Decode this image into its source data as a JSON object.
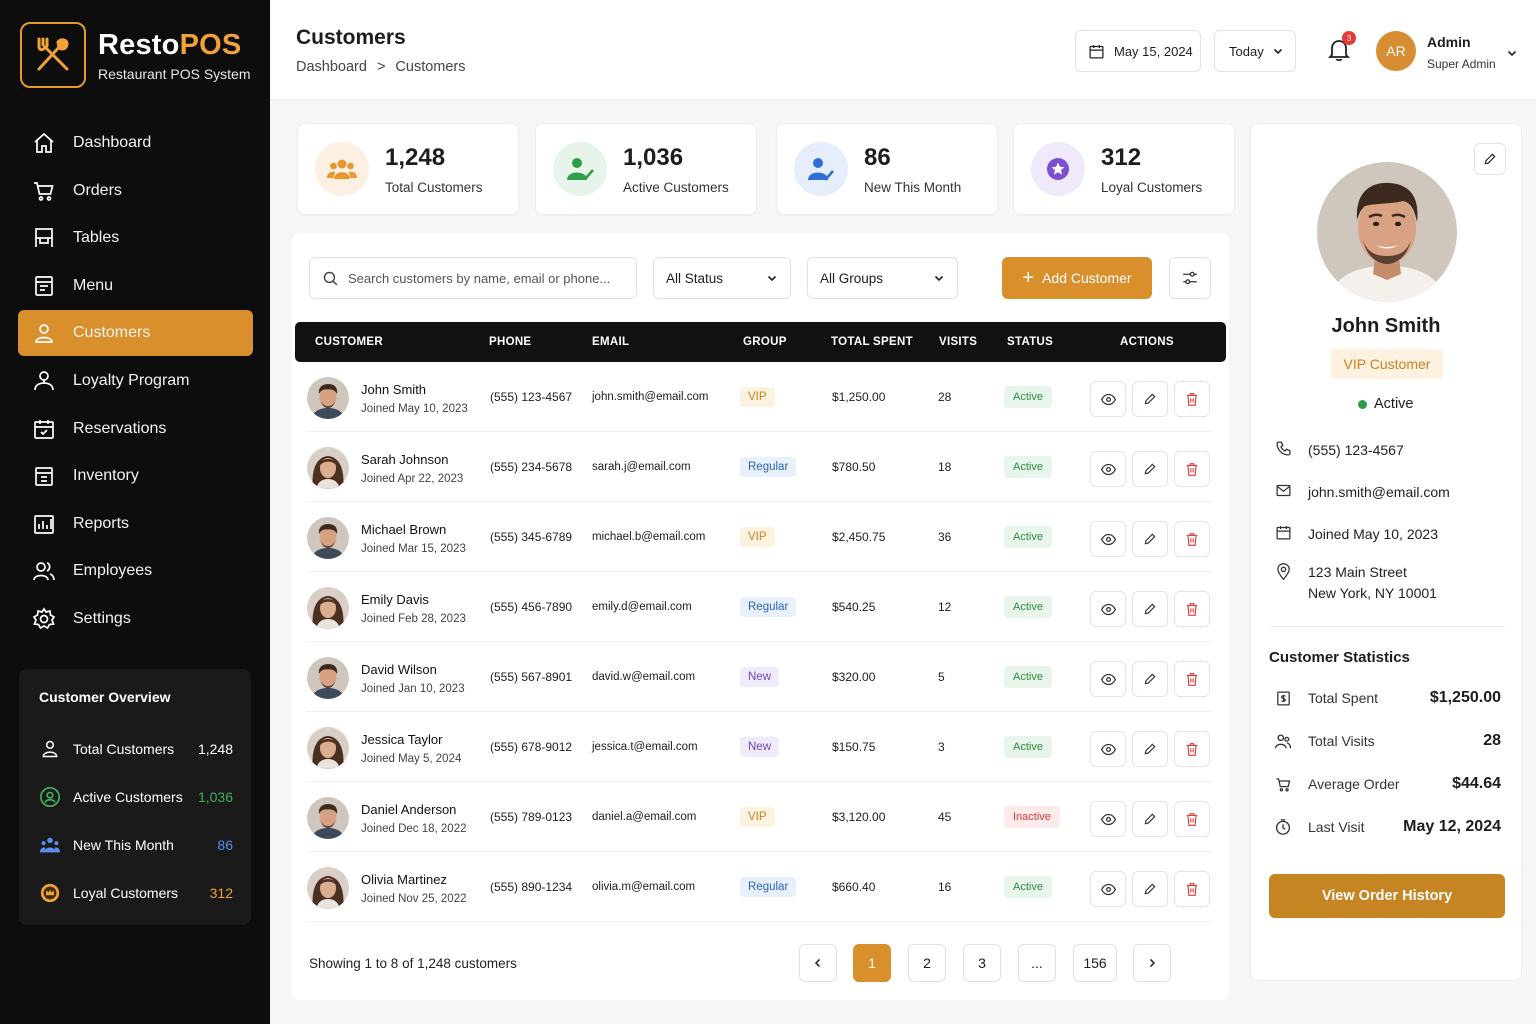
{
  "brand": {
    "name_part1": "Resto",
    "name_part2": "POS",
    "tagline": "Restaurant POS System"
  },
  "nav": [
    {
      "label": "Dashboard",
      "icon": "home-icon"
    },
    {
      "label": "Orders",
      "icon": "cart-icon"
    },
    {
      "label": "Tables",
      "icon": "table-icon"
    },
    {
      "label": "Menu",
      "icon": "menu-book-icon"
    },
    {
      "label": "Customers",
      "icon": "user-icon",
      "active": true
    },
    {
      "label": "Loyalty Program",
      "icon": "loyalty-icon"
    },
    {
      "label": "Reservations",
      "icon": "calendar-icon"
    },
    {
      "label": "Inventory",
      "icon": "inventory-icon"
    },
    {
      "label": "Reports",
      "icon": "reports-icon"
    },
    {
      "label": "Employees",
      "icon": "employees-icon"
    },
    {
      "label": "Settings",
      "icon": "gear-icon"
    }
  ],
  "overview": {
    "title": "Customer Overview",
    "items": [
      {
        "label": "Total Customers",
        "value": "1,248",
        "color": "#ffffff"
      },
      {
        "label": "Active Customers",
        "value": "1,036",
        "color": "#3fb15c"
      },
      {
        "label": "New This Month",
        "value": "86",
        "color": "#5a8ff0"
      },
      {
        "label": "Loyal Customers",
        "value": "312",
        "color": "#f0a239"
      }
    ]
  },
  "header": {
    "title": "Customers",
    "breadcrumb": [
      "Dashboard",
      ">",
      "Customers"
    ],
    "date": "May 15, 2024",
    "range": "Today",
    "notifications": "3",
    "user_initials": "AR",
    "user_name": "Admin",
    "user_role": "Super Admin"
  },
  "stats": [
    {
      "value": "1,248",
      "label": "Total Customers",
      "color": "#e8962f",
      "bg": "#fdf0e2"
    },
    {
      "value": "1,036",
      "label": "Active Customers",
      "color": "#2f9e4a",
      "bg": "#e6f4e9"
    },
    {
      "value": "86",
      "label": "New This Month",
      "color": "#2f6fd6",
      "bg": "#e6eefb"
    },
    {
      "value": "312",
      "label": "Loyal Customers",
      "color": "#7b4fd1",
      "bg": "#efe9fb"
    }
  ],
  "toolbar": {
    "search_placeholder": "Search customers by name, email or phone...",
    "status_filter": "All Status",
    "group_filter": "All Groups",
    "add_label": "Add Customer"
  },
  "table": {
    "columns": [
      "CUSTOMER",
      "PHONE",
      "EMAIL",
      "GROUP",
      "TOTAL SPENT",
      "VISITS",
      "STATUS",
      "ACTIONS"
    ],
    "rows": [
      {
        "name": "John Smith",
        "joined": "Joined May 10, 2023",
        "phone": "(555) 123-4567",
        "email": "john.smith@email.com",
        "group": "VIP",
        "spent": "$1,250.00",
        "visits": "28",
        "status": "Active",
        "gender": "m"
      },
      {
        "name": "Sarah Johnson",
        "joined": "Joined Apr 22, 2023",
        "phone": "(555) 234-5678",
        "email": "sarah.j@email.com",
        "group": "Regular",
        "spent": "$780.50",
        "visits": "18",
        "status": "Active",
        "gender": "f"
      },
      {
        "name": "Michael Brown",
        "joined": "Joined Mar 15, 2023",
        "phone": "(555) 345-6789",
        "email": "michael.b@email.com",
        "group": "VIP",
        "spent": "$2,450.75",
        "visits": "36",
        "status": "Active",
        "gender": "m"
      },
      {
        "name": "Emily Davis",
        "joined": "Joined Feb 28, 2023",
        "phone": "(555) 456-7890",
        "email": "emily.d@email.com",
        "group": "Regular",
        "spent": "$540.25",
        "visits": "12",
        "status": "Active",
        "gender": "f"
      },
      {
        "name": "David Wilson",
        "joined": "Joined Jan 10, 2023",
        "phone": "(555) 567-8901",
        "email": "david.w@email.com",
        "group": "New",
        "spent": "$320.00",
        "visits": "5",
        "status": "Active",
        "gender": "m"
      },
      {
        "name": "Jessica Taylor",
        "joined": "Joined May 5, 2024",
        "phone": "(555) 678-9012",
        "email": "jessica.t@email.com",
        "group": "New",
        "spent": "$150.75",
        "visits": "3",
        "status": "Active",
        "gender": "f"
      },
      {
        "name": "Daniel Anderson",
        "joined": "Joined Dec 18, 2022",
        "phone": "(555) 789-0123",
        "email": "daniel.a@email.com",
        "group": "VIP",
        "spent": "$3,120.00",
        "visits": "45",
        "status": "Inactive",
        "gender": "m"
      },
      {
        "name": "Olivia Martinez",
        "joined": "Joined Nov 25, 2022",
        "phone": "(555) 890-1234",
        "email": "olivia.m@email.com",
        "group": "Regular",
        "spent": "$660.40",
        "visits": "16",
        "status": "Active",
        "gender": "f"
      }
    ]
  },
  "pagination": {
    "showing": "Showing 1 to 8 of 1,248 customers",
    "pages": [
      "1",
      "2",
      "3",
      "...",
      "156"
    ],
    "current": "1"
  },
  "profile": {
    "name": "John Smith",
    "group": "VIP Customer",
    "status": "Active",
    "phone": "(555) 123-4567",
    "email": "john.smith@email.com",
    "joined": "Joined May 10, 2023",
    "address_line1": "123 Main Street",
    "address_line2": "New York, NY 10001",
    "stats_title": "Customer Statistics",
    "stats": [
      {
        "label": "Total Spent",
        "value": "$1,250.00"
      },
      {
        "label": "Total Visits",
        "value": "28"
      },
      {
        "label": "Average Order",
        "value": "$44.64"
      },
      {
        "label": "Last Visit",
        "value": "May 12, 2024"
      }
    ],
    "history_label": "View Order History"
  }
}
